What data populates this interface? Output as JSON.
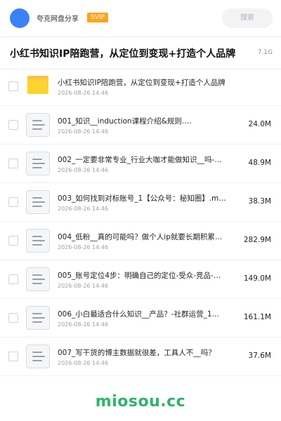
{
  "header": {
    "user_name": "夸克网盘分享",
    "badge": "SVIP",
    "search_placeholder": "搜索",
    "avatar_color": "#3b82f6",
    "badge_color": "#ffa31a"
  },
  "folder": {
    "title": "小红书知识IP陪跑营，从定位到变现+打造个人品牌",
    "size": "7.1G"
  },
  "files": [
    {
      "type": "folder",
      "name": "小红书知识IP陪跑营，从定位到变现+打造个人品牌",
      "date": "2026-08-26 14:46",
      "size": ""
    },
    {
      "type": "doc",
      "name": "001_知识__induction课程介绍&规则.…",
      "date": "2026-08-26 14:46",
      "size": "24.0M"
    },
    {
      "type": "doc",
      "name": "002_一定要非常专业_行业大咖才能做知识__吗-…",
      "date": "2026-08-26 14:46",
      "size": "48.9M"
    },
    {
      "type": "doc",
      "name": "003_如何找到对标账号_1【公众号：秘知圈】.m…",
      "date": "2026-08-26 14:46",
      "size": "38.3M"
    },
    {
      "type": "doc",
      "name": "004_低粉__真的可能吗？做个人ip就要长期积累…",
      "date": "2026-08-26 14:46",
      "size": "282.9M"
    },
    {
      "type": "doc",
      "name": "005_账号定位4步：明确自己的定位-受众-竞品-…",
      "date": "2026-08-26 14:46",
      "size": "149.0M"
    },
    {
      "type": "doc",
      "name": "006_小白最适合什么知识__产品？-社群运营_1…",
      "date": "2026-08-26 14:46",
      "size": "161.1M"
    },
    {
      "type": "doc",
      "name": "007_写干货的博主数据就很差，工具人不__吗？",
      "date": "2026-08-26 14:46",
      "size": "37.6M"
    }
  ],
  "watermark": "miosou.cc"
}
